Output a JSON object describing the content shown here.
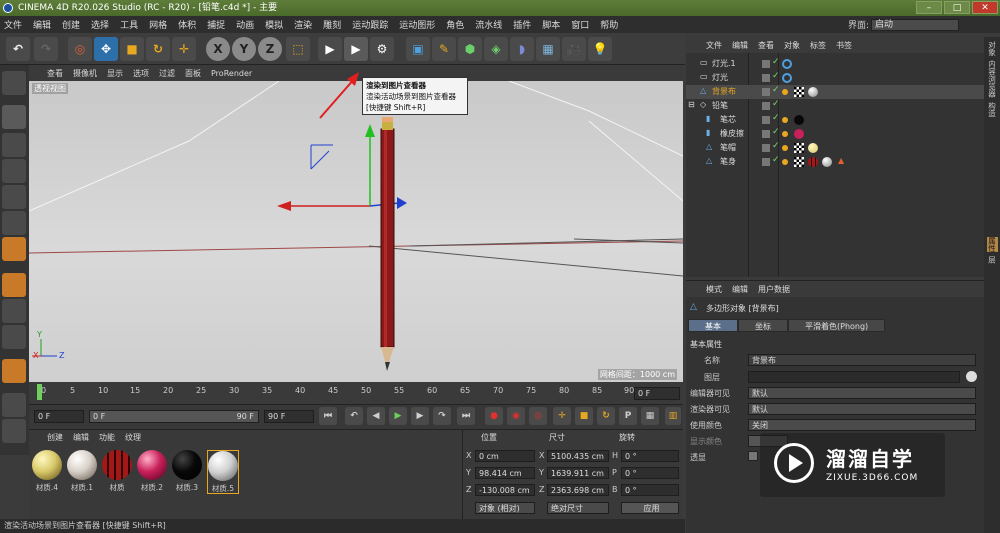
{
  "window": {
    "title": "CINEMA 4D R20.026 Studio (RC - R20) - [铅笔.c4d *] - 主要"
  },
  "menu": [
    "文件",
    "编辑",
    "创建",
    "选择",
    "工具",
    "网格",
    "体积",
    "捕捉",
    "动画",
    "模拟",
    "渲染",
    "雕刻",
    "运动跟踪",
    "运动图形",
    "角色",
    "流水线",
    "插件",
    "脚本",
    "窗口",
    "帮助"
  ],
  "interface": {
    "label": "界面:",
    "value": "启动"
  },
  "viewport": {
    "menu": [
      "查看",
      "摄像机",
      "显示",
      "选项",
      "过滤",
      "面板",
      "ProRender"
    ],
    "camera_label": "透视视图",
    "grid_spacing": "网格间距：1000 cm",
    "axis_labels": {
      "y": "Y",
      "x": "X",
      "z": "Z"
    }
  },
  "tooltip": {
    "title": "渲染到图片查看器",
    "desc": "渲染活动场景到图片查看器",
    "shortcut": "[快捷键 Shift+R]"
  },
  "timeline": {
    "ticks": [
      "0",
      "5",
      "10",
      "15",
      "20",
      "25",
      "30",
      "35",
      "40",
      "45",
      "50",
      "55",
      "60",
      "65",
      "70",
      "75",
      "80",
      "85",
      "90"
    ],
    "end_frame": "0 F"
  },
  "transport": {
    "start": "0 F",
    "current": "0 F",
    "range_end": "90 F",
    "end": "90 F"
  },
  "materials": {
    "menu": [
      "创建",
      "编辑",
      "功能",
      "纹理"
    ],
    "items": [
      {
        "label": "材质.4",
        "color": "#d8c86a"
      },
      {
        "label": "材质.1",
        "color": "#d8d0c8"
      },
      {
        "label": "材质",
        "color": "#a01818"
      },
      {
        "label": "材质.2",
        "color": "#c8205a"
      },
      {
        "label": "材质.3",
        "color": "#080808"
      },
      {
        "label": "材质.5",
        "color": "#d0d0d0"
      }
    ]
  },
  "coords": {
    "headers": [
      "位置",
      "尺寸",
      "旋转"
    ],
    "rows": [
      {
        "axis": "X",
        "pos": "0 cm",
        "size_axis": "X",
        "size": "5100.435 cm",
        "rot_axis": "H",
        "rot": "0 °"
      },
      {
        "axis": "Y",
        "pos": "98.414 cm",
        "size_axis": "Y",
        "size": "1639.911 cm",
        "rot_axis": "P",
        "rot": "0 °"
      },
      {
        "axis": "Z",
        "pos": "-130.008 cm",
        "size_axis": "Z",
        "size": "2363.698 cm",
        "rot_axis": "B",
        "rot": "0 °"
      }
    ],
    "mode": "对象 (相对)",
    "size_mode": "绝对尺寸",
    "apply": "应用"
  },
  "status": "渲染活动场景到图片查看器 [快捷键 Shift+R]",
  "object_manager": {
    "menu": [
      "文件",
      "编辑",
      "查看",
      "对象",
      "标签",
      "书签"
    ],
    "objects": [
      {
        "name": "灯光.1"
      },
      {
        "name": "灯光"
      },
      {
        "name": "背景布"
      },
      {
        "name": "铅笔"
      },
      {
        "name": "笔芯"
      },
      {
        "name": "橡皮擦"
      },
      {
        "name": "笔帽"
      },
      {
        "name": "笔身"
      }
    ]
  },
  "attributes": {
    "menu": [
      "模式",
      "编辑",
      "用户数据"
    ],
    "object_title": "多边形对象 [背景布]",
    "tabs": [
      "基本",
      "坐标",
      "平滑着色(Phong)"
    ],
    "section": "基本属性",
    "fields": [
      {
        "label": "名称",
        "value": "背景布"
      },
      {
        "label": "图层",
        "value": ""
      },
      {
        "label": "编辑器可见",
        "value": "默认"
      },
      {
        "label": "渲染器可见",
        "value": "默认"
      },
      {
        "label": "使用颜色",
        "value": "关闭"
      },
      {
        "label": "显示颜色",
        "value": ""
      },
      {
        "label": "透显",
        "value": ""
      }
    ]
  },
  "right_tabs": [
    "对象",
    "内容浏览器",
    "构造",
    "属性",
    "层"
  ],
  "watermark": {
    "title": "溜溜自学",
    "url": "ZIXUE.3D66.COM"
  }
}
